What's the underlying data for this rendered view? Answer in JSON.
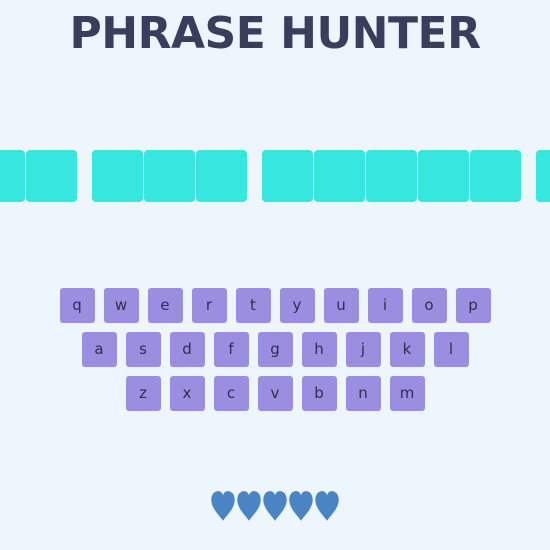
{
  "title": "PHRASE HUNTER",
  "phrase": {
    "tiles": [
      "letter",
      "letter",
      "space",
      "letter",
      "letter",
      "letter",
      "space",
      "letter",
      "letter",
      "letter",
      "letter",
      "letter",
      "space",
      "letter"
    ]
  },
  "keyboard": {
    "rows": [
      [
        "q",
        "w",
        "e",
        "r",
        "t",
        "y",
        "u",
        "i",
        "o",
        "p"
      ],
      [
        "a",
        "s",
        "d",
        "f",
        "g",
        "h",
        "j",
        "k",
        "l"
      ],
      [
        "z",
        "x",
        "c",
        "v",
        "b",
        "n",
        "m"
      ]
    ]
  },
  "lives": {
    "remaining": 5,
    "total": 5,
    "icon": "heart-icon",
    "color": "#4b84c2"
  },
  "colors": {
    "background": "#eef6fd",
    "tile": "#38e6e0",
    "key": "#9b8ee0",
    "title": "#3a3d5c"
  }
}
